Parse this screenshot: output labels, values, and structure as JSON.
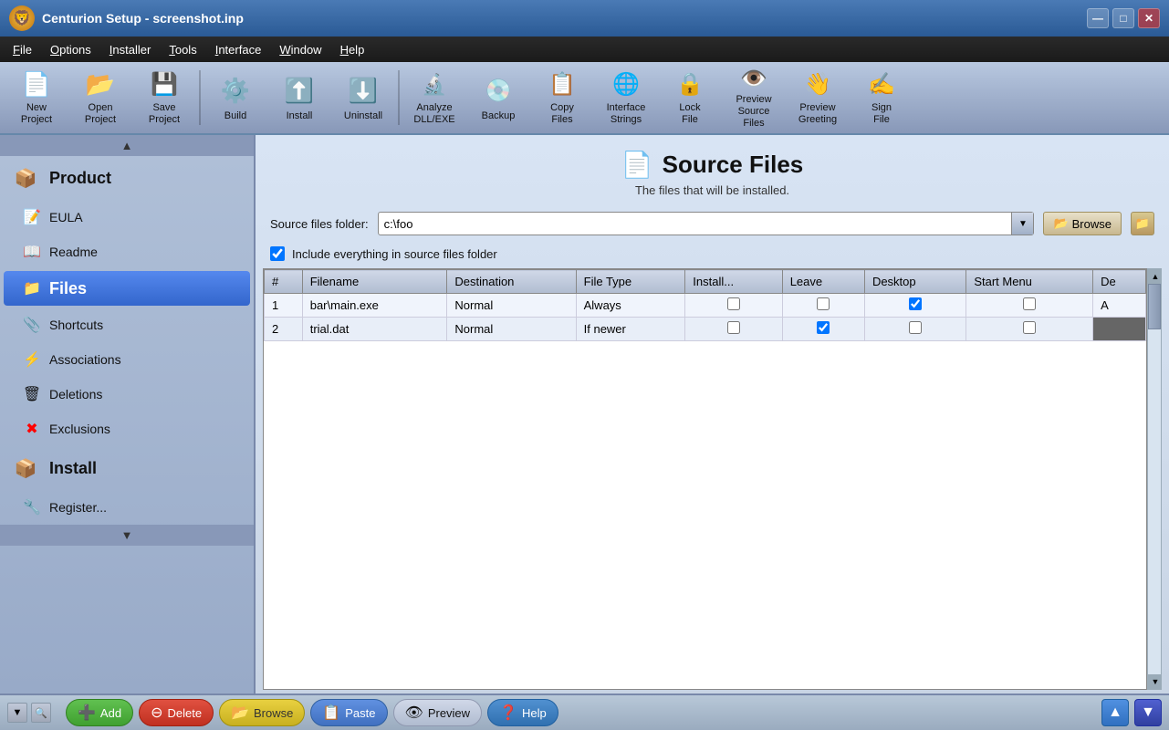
{
  "app": {
    "title": "Centurion Setup - screenshot.inp",
    "icon": "🦁"
  },
  "window_controls": {
    "minimize": "—",
    "maximize": "□",
    "close": "✕"
  },
  "menu": {
    "items": [
      {
        "label": "File",
        "underline": "F"
      },
      {
        "label": "Options",
        "underline": "O"
      },
      {
        "label": "Installer",
        "underline": "I"
      },
      {
        "label": "Tools",
        "underline": "T"
      },
      {
        "label": "Interface",
        "underline": "I"
      },
      {
        "label": "Window",
        "underline": "W"
      },
      {
        "label": "Help",
        "underline": "H"
      }
    ]
  },
  "toolbar": {
    "buttons": [
      {
        "id": "new-project",
        "label": "New\nProject",
        "icon": "📄"
      },
      {
        "id": "open-project",
        "label": "Open\nProject",
        "icon": "📂"
      },
      {
        "id": "save-project",
        "label": "Save\nProject",
        "icon": "💾"
      },
      {
        "id": "build",
        "label": "Build",
        "icon": "⚙️"
      },
      {
        "id": "install",
        "label": "Install",
        "icon": "⬆️"
      },
      {
        "id": "uninstall",
        "label": "Uninstall",
        "icon": "⬇️"
      },
      {
        "id": "analyze",
        "label": "Analyze\nDLL/EXE",
        "icon": "🔍"
      },
      {
        "id": "backup",
        "label": "Backup",
        "icon": "🔒"
      },
      {
        "id": "copy-files",
        "label": "Copy\nFiles",
        "icon": "📋"
      },
      {
        "id": "interface-strings",
        "label": "Interface\nStrings",
        "icon": "🌐"
      },
      {
        "id": "lock-file",
        "label": "Lock\nFile",
        "icon": "🔐"
      },
      {
        "id": "preview-source",
        "label": "Preview\nSource Files",
        "icon": "👁️"
      },
      {
        "id": "preview-greeting",
        "label": "Preview\nGreeting",
        "icon": "👋"
      },
      {
        "id": "sign-file",
        "label": "Sign\nFile",
        "icon": "✍️"
      }
    ]
  },
  "sidebar": {
    "sections": [
      {
        "id": "product",
        "label": "Product",
        "icon": "📦",
        "items": [
          {
            "id": "eula",
            "label": "EULA",
            "icon": "📝"
          },
          {
            "id": "readme",
            "label": "Readme",
            "icon": "📖"
          }
        ]
      },
      {
        "id": "files",
        "label": "Files",
        "icon": "📁",
        "active": true,
        "items": [
          {
            "id": "shortcuts",
            "label": "Shortcuts",
            "icon": "🔗"
          },
          {
            "id": "associations",
            "label": "Associations",
            "icon": "⚡"
          },
          {
            "id": "deletions",
            "label": "Deletions",
            "icon": "📁"
          },
          {
            "id": "exclusions",
            "label": "Exclusions",
            "icon": "❌"
          }
        ]
      },
      {
        "id": "install",
        "label": "Install",
        "icon": "⬆️"
      }
    ]
  },
  "content": {
    "title": "Source Files",
    "subtitle": "The files that will be installed.",
    "source_folder_label": "Source files folder:",
    "source_folder_value": "c:\\foo",
    "source_folder_placeholder": "c:\\foo",
    "include_everything_label": "Include everything in source files folder",
    "include_everything_checked": true,
    "browse_label": "Browse",
    "table": {
      "columns": [
        "#",
        "Filename",
        "Destination",
        "File Type",
        "Install...",
        "Leave",
        "Desktop",
        "Start Menu",
        "De"
      ],
      "rows": [
        {
          "num": "1",
          "filename": "bar\\main.exe",
          "destination": "Normal",
          "file_type": "Always",
          "install": false,
          "leave": false,
          "desktop": true,
          "start_menu": false,
          "de": "A"
        },
        {
          "num": "2",
          "filename": "trial.dat",
          "destination": "Normal",
          "file_type": "If newer",
          "install": false,
          "leave": true,
          "desktop": false,
          "start_menu": false,
          "de": ""
        }
      ]
    }
  },
  "bottom_toolbar": {
    "add_label": "Add",
    "delete_label": "Delete",
    "browse_label": "Browse",
    "paste_label": "Paste",
    "preview_label": "Preview",
    "help_label": "Help",
    "up_icon": "▲",
    "down_icon": "▼",
    "icons": {
      "add": "➕",
      "delete": "➖",
      "browse": "📂",
      "paste": "📋",
      "preview": "👁",
      "help": "❓"
    }
  }
}
